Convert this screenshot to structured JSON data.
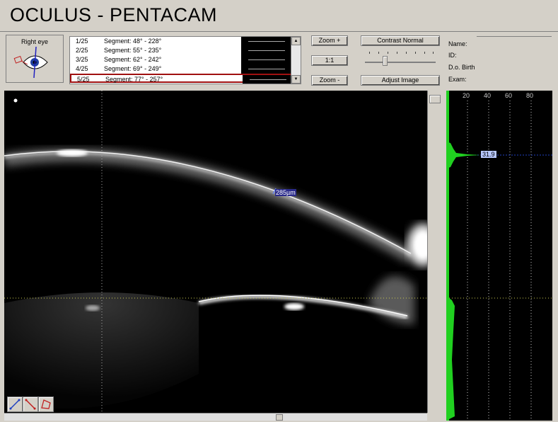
{
  "app": {
    "title": "OCULUS  -  PENTACAM"
  },
  "eye": {
    "label": "Right eye"
  },
  "segments": [
    {
      "num": "1/25",
      "text": "Segment: 48° - 228°"
    },
    {
      "num": "2/25",
      "text": "Segment: 55° - 235°"
    },
    {
      "num": "3/25",
      "text": "Segment: 62° - 242°"
    },
    {
      "num": "4/25",
      "text": "Segment: 69° - 249°"
    },
    {
      "num": "5/25",
      "text": "Segment: 77° - 257°"
    }
  ],
  "selected_segment_index": 4,
  "buttons": {
    "zoom_in": "Zoom +",
    "one_to_one": "1:1",
    "zoom_out": "Zoom -",
    "contrast": "Contrast Normal",
    "adjust": "Adjust Image"
  },
  "patient": {
    "name_label": "Name:",
    "id_label": "ID:",
    "dob_label": "D.o. Birth",
    "exam_label": "Exam:"
  },
  "image": {
    "measurement_label": "285µm"
  },
  "graph": {
    "ticks": [
      "20",
      "40",
      "60",
      "80"
    ],
    "peak_label": "31.9",
    "fill_color": "#20d020"
  },
  "colors": {
    "selection_border": "#a01010",
    "background": "#d4d0c8"
  }
}
